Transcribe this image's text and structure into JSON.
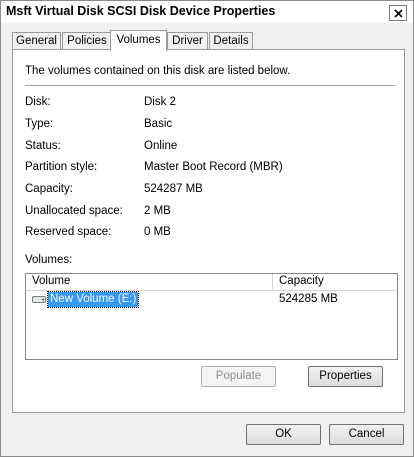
{
  "window": {
    "title": "Msft Virtual Disk SCSI Disk Device Properties"
  },
  "tabs": [
    {
      "label": "General"
    },
    {
      "label": "Policies"
    },
    {
      "label": "Volumes"
    },
    {
      "label": "Driver"
    },
    {
      "label": "Details"
    }
  ],
  "active_tab": "Volumes",
  "panel": {
    "intro": "The volumes contained on this disk are listed below.",
    "fields": [
      {
        "label": "Disk:",
        "value": "Disk 2"
      },
      {
        "label": "Type:",
        "value": "Basic"
      },
      {
        "label": "Status:",
        "value": "Online"
      },
      {
        "label": "Partition style:",
        "value": "Master Boot Record (MBR)"
      },
      {
        "label": "Capacity:",
        "value": "524287 MB"
      },
      {
        "label": "Unallocated space:",
        "value": "2 MB"
      },
      {
        "label": "Reserved space:",
        "value": "0 MB"
      }
    ],
    "volumes_label": "Volumes:",
    "volumes_table": {
      "columns": [
        "Volume",
        "Capacity"
      ],
      "rows": [
        {
          "name": "New Volume (E:)",
          "capacity": "524285 MB",
          "icon": "drive-icon",
          "selected": true
        }
      ]
    },
    "populate_label": "Populate",
    "properties_label": "Properties"
  },
  "footer": {
    "ok_label": "OK",
    "cancel_label": "Cancel"
  },
  "colors": {
    "selection": "#3399ff",
    "panel_bg": "#ffffff",
    "dialog_bg": "#f0f0f0"
  }
}
